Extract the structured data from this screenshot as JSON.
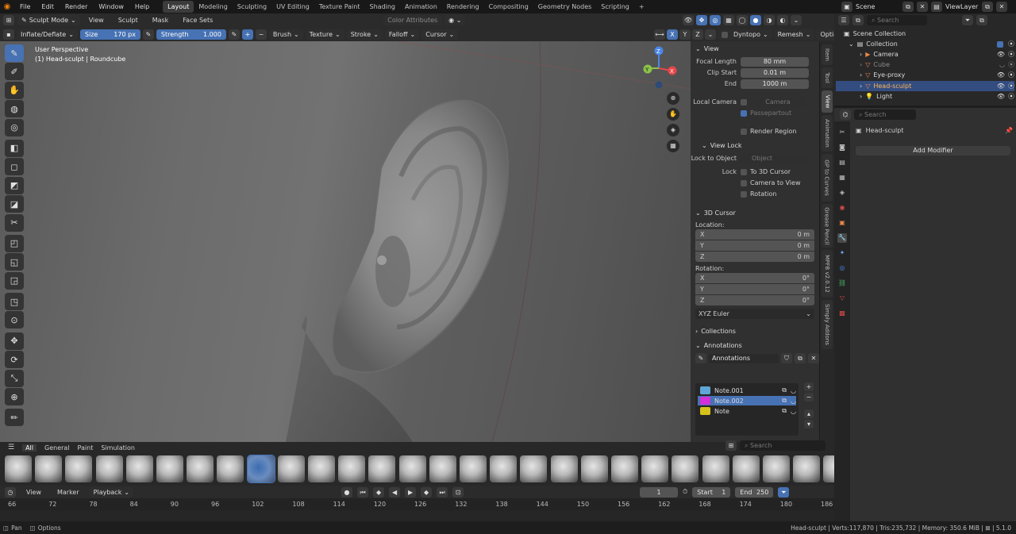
{
  "menu": [
    "File",
    "Edit",
    "Render",
    "Window",
    "Help"
  ],
  "workspaces": [
    "Layout",
    "Modeling",
    "Sculpting",
    "UV Editing",
    "Texture Paint",
    "Shading",
    "Animation",
    "Rendering",
    "Compositing",
    "Geometry Nodes",
    "Scripting"
  ],
  "workspace_add": "+",
  "scene": "Scene",
  "viewlayer": "ViewLayer",
  "header": {
    "mode": "Sculpt Mode",
    "items": [
      "View",
      "Sculpt",
      "Mask",
      "Face Sets"
    ],
    "color_attributes": "Color Attributes"
  },
  "tool_settings": {
    "brush": "Inflate/Deflate",
    "size_label": "Size",
    "size_value": "170 px",
    "strength_label": "Strength",
    "strength_value": "1.000",
    "plus": "+",
    "minus": "−",
    "menus": [
      "Brush",
      "Texture",
      "Stroke",
      "Falloff",
      "Cursor"
    ],
    "axes": [
      "X",
      "Y",
      "Z"
    ],
    "dyntopo": "Dyntopo",
    "remesh": "Remesh",
    "options": "Options"
  },
  "viewport": {
    "perspective": "User Perspective",
    "object": "(1) Head-sculpt | Roundcube",
    "gizmo": {
      "x": "X",
      "y": "Y",
      "z": "Z"
    }
  },
  "npanel": {
    "view_header": "View",
    "focal_length_label": "Focal Length",
    "focal_length": "80 mm",
    "clip_start_label": "Clip Start",
    "clip_start": "0.01 m",
    "end_label": "End",
    "clip_end": "1000 m",
    "local_camera_label": "Local Camera",
    "camera_placeholder": "Camera",
    "passepartout": "Passepartout",
    "render_region": "Render Region",
    "view_lock_header": "View Lock",
    "lock_to_object_label": "Lock to Object",
    "object_placeholder": "Object",
    "lock_label": "Lock",
    "to_3d_cursor": "To 3D Cursor",
    "camera_to_view": "Camera to View",
    "rotation_lock": "Rotation",
    "cursor_header": "3D Cursor",
    "location_label": "Location:",
    "loc": [
      {
        "axis": "X",
        "value": "0 m"
      },
      {
        "axis": "Y",
        "value": "0 m"
      },
      {
        "axis": "Z",
        "value": "0 m"
      }
    ],
    "rotation_label": "Rotation:",
    "rot": [
      {
        "axis": "X",
        "value": "0°"
      },
      {
        "axis": "Y",
        "value": "0°"
      },
      {
        "axis": "Z",
        "value": "0°"
      }
    ],
    "rotation_mode": "XYZ Euler",
    "collections_header": "Collections",
    "annotations_header": "Annotations",
    "annotations_name": "Annotations",
    "notes": [
      {
        "name": "Note.001",
        "color": "#5fa6d6"
      },
      {
        "name": "Note.002",
        "color": "#d42fd9"
      },
      {
        "name": "Note",
        "color": "#d6c21a"
      }
    ]
  },
  "side_tabs": [
    "Item",
    "Tool",
    "View",
    "Animation",
    "GP to Curves",
    "Grease Pencil",
    "MPFB v2.0.12",
    "Simply Addons"
  ],
  "asset_tabs": [
    "All",
    "General",
    "Paint",
    "Simulation"
  ],
  "asset_search": "Search",
  "timeline": {
    "menus": [
      "View",
      "Marker",
      "Playback"
    ],
    "current_frame": "1",
    "start_label": "Start",
    "start": "1",
    "end_label": "End",
    "end": "250",
    "ticks": [
      "66",
      "72",
      "78",
      "84",
      "90",
      "96",
      "102",
      "108",
      "114",
      "120",
      "126",
      "132",
      "138",
      "144",
      "150",
      "156",
      "162",
      "168",
      "174",
      "180",
      "186"
    ]
  },
  "status": {
    "pan": "Pan",
    "options": "Options",
    "right": "Head-sculpt | Verts:117,870 | Tris:235,732 | Memory: 350.6 MiB | ⊠ | 5.1.0"
  },
  "outliner": {
    "search": "Search",
    "scene_collection": "Scene Collection",
    "collection": "Collection",
    "items": [
      "Camera",
      "Cube",
      "Eye-proxy",
      "Head-sculpt",
      "Light"
    ]
  },
  "properties": {
    "search": "Search",
    "object": "Head-sculpt",
    "add_modifier": "Add Modifier"
  }
}
